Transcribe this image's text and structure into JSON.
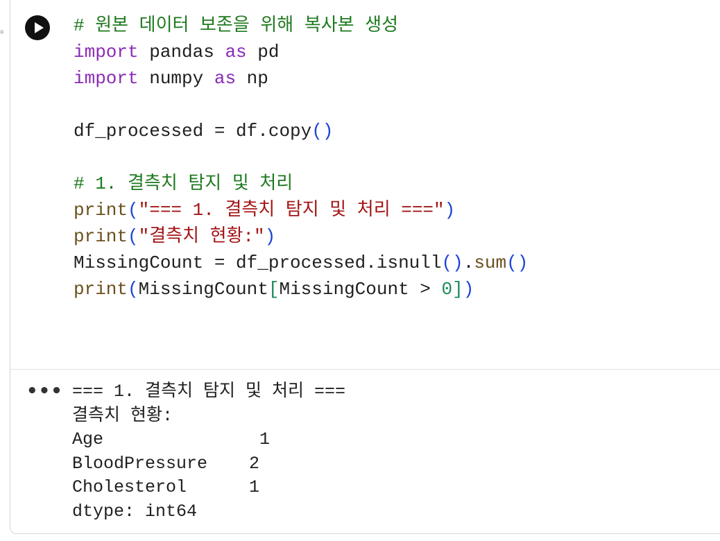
{
  "cell": {
    "run_button_icon": "play-icon",
    "code": {
      "line1": "# 원본 데이터 보존을 위해 복사본 생성",
      "line2_kw": "import",
      "line2_mod": " pandas ",
      "line2_as": "as",
      "line2_alias": " pd",
      "line3_kw": "import",
      "line3_mod": " numpy ",
      "line3_as": "as",
      "line3_alias": " np",
      "line5_lhs": "df_processed = df.copy",
      "line5_paren": "()",
      "line7": "# 1. 결측치 탐지 및 처리",
      "line8_fn": "print",
      "line8_open": "(",
      "line8_str": "\"=== 1. 결측치 탐지 및 처리 ===\"",
      "line8_close": ")",
      "line9_fn": "print",
      "line9_open": "(",
      "line9_str": "\"결측치 현황:\"",
      "line9_close": ")",
      "line10_lhs": "MissingCount = df_processed.isnull",
      "line10_p1": "()",
      "line10_dot": ".",
      "line10_sum": "sum",
      "line10_p2": "()",
      "line11_fn": "print",
      "line11_open": "(",
      "line11_mid": "MissingCount",
      "line11_bopen": "[",
      "line11_expr": "MissingCount > ",
      "line11_zero": "0",
      "line11_bclose": "]",
      "line11_close": ")"
    }
  },
  "output": {
    "more_label": "•••",
    "lines": [
      "=== 1. 결측치 탐지 및 처리 ===",
      "결측치 현황:",
      "Age               1",
      "BloodPressure    2",
      "Cholesterol      1",
      "dtype: int64"
    ]
  },
  "colors": {
    "comment": "#1f7a1f",
    "keyword": "#8a2bb5",
    "string": "#a31515",
    "paren": "#1a44d6",
    "number": "#1b8a5a"
  }
}
